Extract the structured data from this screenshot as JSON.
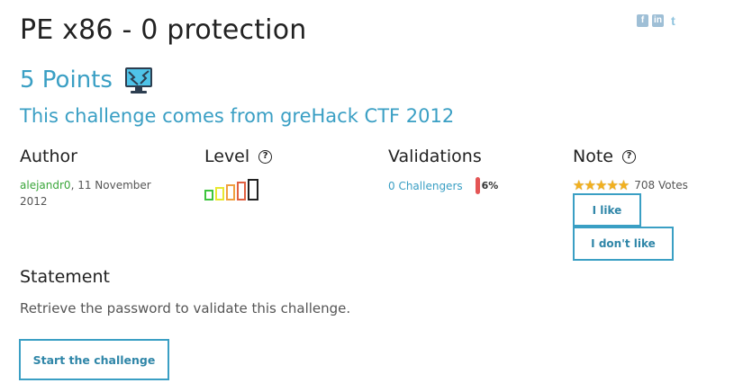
{
  "challenge": {
    "title": "PE x86 - 0 protection",
    "points": "5 Points",
    "origin": "This challenge comes from greHack CTF 2012",
    "category_icon": "cracking-computer-icon"
  },
  "social": {
    "facebook_label": "f",
    "linkedin_label": "in",
    "twitter_label": "t"
  },
  "author": {
    "heading": "Author",
    "name": "alejandr0",
    "date": ",  11 November 2012"
  },
  "level": {
    "heading": "Level",
    "help": "?",
    "current_level": 1,
    "max_level": 5,
    "colors": [
      "#3ec43e",
      "#e8e830",
      "#f0a040",
      "#e06040",
      "#222222"
    ]
  },
  "validations": {
    "heading": "Validations",
    "challengers": "0 Challengers",
    "percent": "6%"
  },
  "note": {
    "heading": "Note",
    "help": "?",
    "stars": "★★★★★",
    "rating": 5,
    "votes": "708 Votes",
    "like_label": "I like",
    "dislike_label": "I don't like"
  },
  "statement": {
    "heading": "Statement",
    "text": "Retrieve the password to validate this challenge."
  },
  "actions": {
    "start_label": "Start the challenge"
  },
  "colors": {
    "accent": "#3a9fc4",
    "author_link": "#3aa63a",
    "percent_bar": "#e45555",
    "stars": "#f2b01e"
  }
}
